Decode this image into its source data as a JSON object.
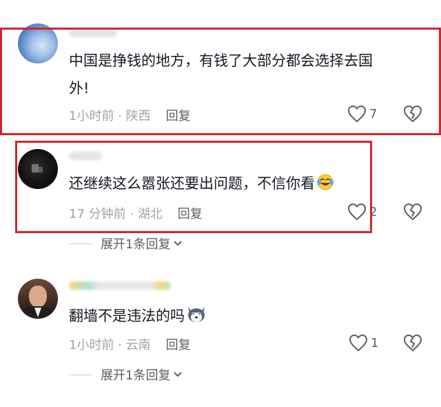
{
  "comments": [
    {
      "text_line1": "中国是挣钱的地方，有钱了大部分都会选择去国",
      "text_line2": "外!",
      "time_location": "1小时前 · 陕西",
      "reply_label": "回复",
      "like_count": "7",
      "avatar_icon": "sky-avatar"
    },
    {
      "text": "还继续这么嚣张还要出问题，不信你看",
      "emoji_icon": "laughing-crying-emoji",
      "time_location": "17 分钟前 · 湖北",
      "reply_label": "回复",
      "like_count": "2",
      "expand_label": "展开1条回复",
      "avatar_icon": "dark-avatar"
    },
    {
      "text": "翻墙不是违法的吗",
      "emoji_icon": "husky-emoji",
      "time_location": "1小时前 · 云南",
      "reply_label": "回复",
      "like_count": "1",
      "expand_label": "展开1条回复",
      "avatar_icon": "person-avatar"
    }
  ],
  "colors": {
    "highlight_border": "#d0262d",
    "meta_text": "#a1a3a8",
    "primary_text": "#161823"
  }
}
